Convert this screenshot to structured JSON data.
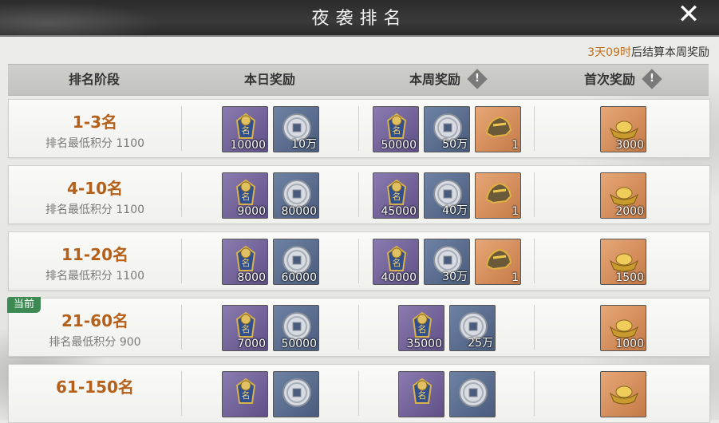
{
  "title": "夜袭排名",
  "notice": {
    "highlight": "3天09时",
    "text": "后结算本周奖励"
  },
  "headers": {
    "stage": "排名阶段",
    "daily": "本日奖励",
    "weekly": "本周奖励",
    "first": "首次奖励",
    "warn": "!"
  },
  "badge_current": "当前",
  "rows": [
    {
      "rank": "1-3名",
      "min": "排名最低积分 1100",
      "daily": [
        "10000",
        "10万"
      ],
      "weekly": [
        "50000",
        "50万",
        "1"
      ],
      "first": [
        "3000"
      ]
    },
    {
      "rank": "4-10名",
      "min": "排名最低积分 1100",
      "daily": [
        "9000",
        "80000"
      ],
      "weekly": [
        "45000",
        "40万",
        "1"
      ],
      "first": [
        "2000"
      ]
    },
    {
      "rank": "11-20名",
      "min": "排名最低积分 1100",
      "daily": [
        "8000",
        "60000"
      ],
      "weekly": [
        "40000",
        "30万",
        "1"
      ],
      "first": [
        "1500"
      ]
    },
    {
      "rank": "21-60名",
      "min": "排名最低积分 900",
      "daily": [
        "7000",
        "50000"
      ],
      "weekly": [
        "35000",
        "25万"
      ],
      "first": [
        "1000"
      ]
    },
    {
      "rank": "61-150名",
      "min": "",
      "daily": [
        "",
        ""
      ],
      "weekly": [
        "",
        ""
      ],
      "first": [
        ""
      ]
    }
  ],
  "icons": {
    "token": "rank-token-icon",
    "coin": "silver-coin-icon",
    "helmet": "helmet-icon",
    "gold": "gold-ingot-icon"
  },
  "colors": {
    "accent": "#b5601a",
    "current_badge": "#3e8a55"
  }
}
